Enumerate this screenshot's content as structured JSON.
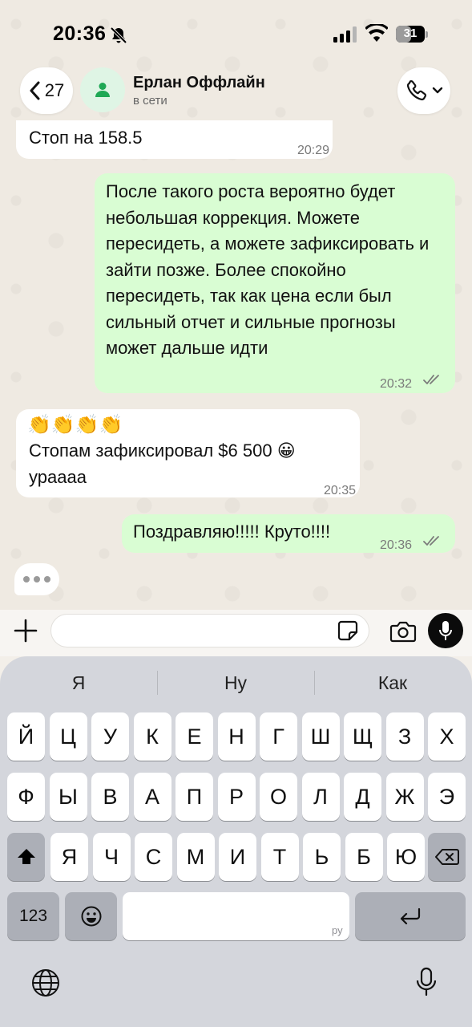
{
  "status_bar": {
    "time": "20:36",
    "battery": "31",
    "battery_fraction": 0.31
  },
  "header": {
    "back_count": "27",
    "contact_name": "Ерлан Оффлайн",
    "contact_status": "в сети"
  },
  "messages": [
    {
      "direction": "in",
      "text": "Стоп на 158.5",
      "time": "20:29"
    },
    {
      "direction": "out",
      "text": "После такого роста вероятно будет небольшая коррекция. Можете пересидеть, а можете зафиксировать и зайти позже. Более спокойно пересидеть, так как цена если был сильный отчет и сильные прогнозы может дальше идти",
      "time": "20:32",
      "read": true
    },
    {
      "direction": "in",
      "emoji": "👏👏👏👏",
      "text": "Стопам зафиксировал $6 500 😀 ураааа",
      "time": "20:35"
    },
    {
      "direction": "out",
      "text": "Поздравляю!!!!! Круто!!!!",
      "time": "20:36",
      "read": true
    }
  ],
  "input": {
    "placeholder": "",
    "value": ""
  },
  "keyboard": {
    "suggestions": [
      "Я",
      "Ну",
      "Как"
    ],
    "rows": [
      [
        "Й",
        "Ц",
        "У",
        "К",
        "Е",
        "Н",
        "Г",
        "Ш",
        "Щ",
        "З",
        "Х"
      ],
      [
        "Ф",
        "Ы",
        "В",
        "А",
        "П",
        "Р",
        "О",
        "Л",
        "Д",
        "Ж",
        "Э"
      ],
      [
        "Я",
        "Ч",
        "С",
        "М",
        "И",
        "Т",
        "Ь",
        "Б",
        "Ю"
      ]
    ],
    "numbers_key": "123",
    "language_hint": "ру"
  },
  "icons": {
    "status": [
      "bell-slash-icon",
      "signal-icon",
      "wifi-icon",
      "battery-icon"
    ],
    "header": [
      "chevron-left-icon",
      "person-icon",
      "phone-icon",
      "chevron-down-icon"
    ],
    "input": [
      "plus-icon",
      "sticker-icon",
      "camera-icon",
      "microphone-icon"
    ],
    "keyboard": [
      "shift-icon",
      "backspace-icon",
      "emoji-icon",
      "return-icon",
      "globe-icon",
      "dictation-icon"
    ]
  },
  "colors": {
    "accent": "#1fa855",
    "outgoing_bubble": "#d9fdd3",
    "incoming_bubble": "#ffffff",
    "read_check": "#7a7a7a"
  }
}
